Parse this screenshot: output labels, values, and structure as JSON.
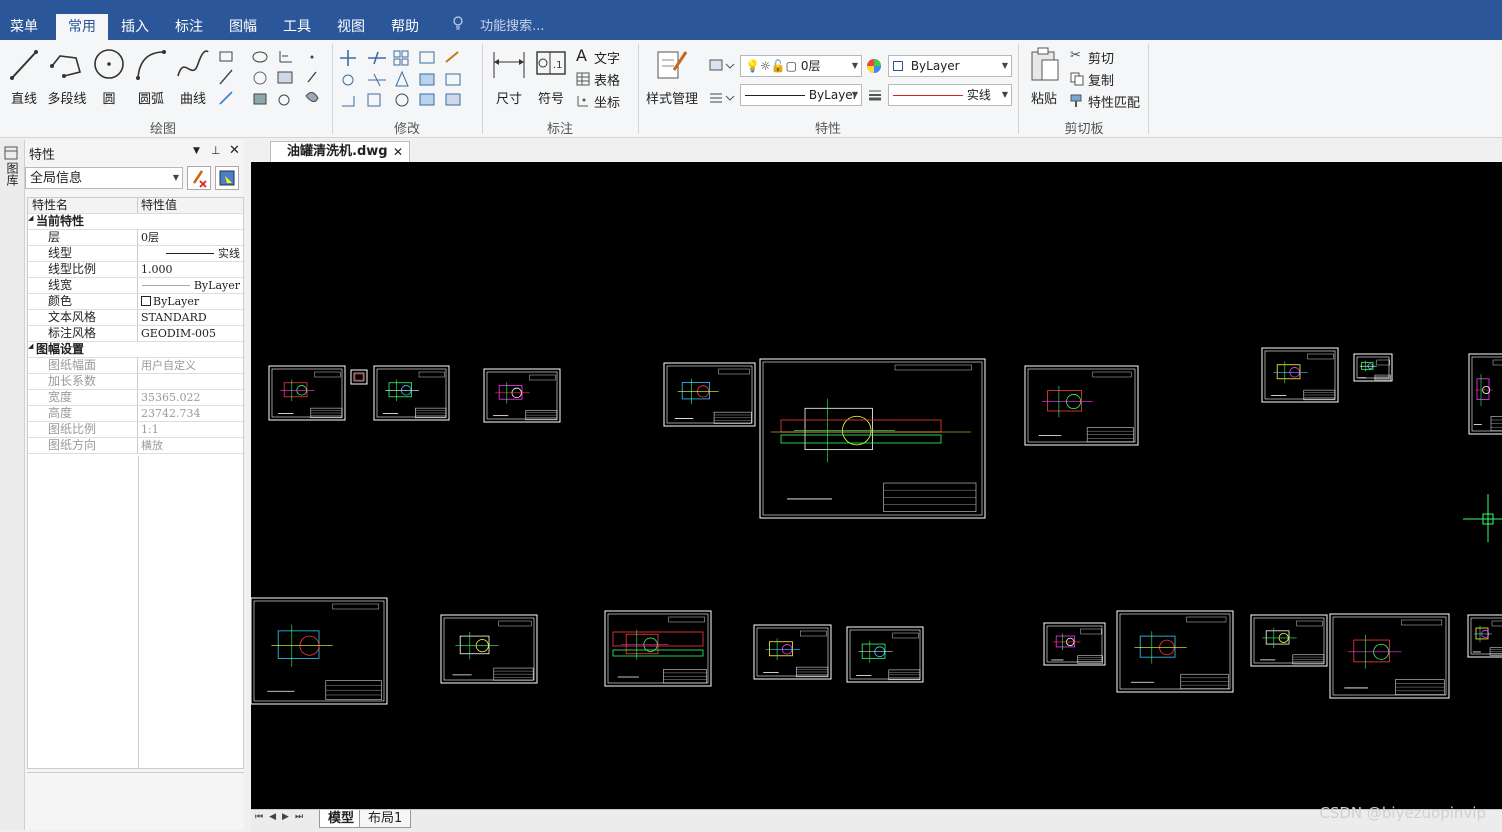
{
  "menu_tabs": [
    {
      "label": "菜单"
    },
    {
      "label": "常用",
      "active": true
    },
    {
      "label": "插入"
    },
    {
      "label": "标注"
    },
    {
      "label": "图幅"
    },
    {
      "label": "工具"
    },
    {
      "label": "视图"
    },
    {
      "label": "帮助"
    }
  ],
  "search_placeholder": "功能搜索...",
  "ribbon": {
    "draw": {
      "line": "直线",
      "polyline": "多段线",
      "circle": "圆",
      "arc": "圆弧",
      "curve": "曲线",
      "group_label": "绘图"
    },
    "modify": {
      "group_label": "修改"
    },
    "annotate": {
      "dimension": "尺寸",
      "symbol": "符号",
      "text": "文字",
      "table": "表格",
      "coordinate": "坐标",
      "group_label": "标注"
    },
    "properties": {
      "style_manager": "样式管理",
      "layer_value": "0层",
      "color_value": "ByLayer",
      "linetype_value": "ByLayer",
      "lineweight_value": "实线",
      "group_label": "特性"
    },
    "clipboard": {
      "paste": "粘贴",
      "cut": "剪切",
      "copy": "复制",
      "match": "特性匹配",
      "group_label": "剪切板"
    }
  },
  "sidebar": {
    "strip_label": "图库"
  },
  "properties_panel": {
    "title": "特性",
    "scope_value": "全局信息",
    "header_name": "特性名",
    "header_value": "特性值",
    "rows": [
      {
        "name": "当前特性",
        "value": "",
        "type": "section"
      },
      {
        "name": "层",
        "value": "0层"
      },
      {
        "name": "线型",
        "value": "实线"
      },
      {
        "name": "线型比例",
        "value": "1.000"
      },
      {
        "name": "线宽",
        "value": "ByLayer"
      },
      {
        "name": "颜色",
        "value": "ByLayer"
      },
      {
        "name": "文本风格",
        "value": "STANDARD"
      },
      {
        "name": "标注风格",
        "value": "GEODIM-005"
      },
      {
        "name": "图幅设置",
        "value": "",
        "type": "section"
      },
      {
        "name": "图纸幅面",
        "value": "用户自定义",
        "type": "muted"
      },
      {
        "name": "加长系数",
        "value": "",
        "type": "muted"
      },
      {
        "name": "宽度",
        "value": "35365.022",
        "type": "muted"
      },
      {
        "name": "高度",
        "value": "23742.734",
        "type": "muted"
      },
      {
        "name": "图纸比例",
        "value": "1:1",
        "type": "muted"
      },
      {
        "name": "图纸方向",
        "value": "横放",
        "type": "muted"
      }
    ]
  },
  "document_tab": {
    "label": "油罐清洗机.dwg"
  },
  "layout_tabs": [
    {
      "label": "模型",
      "active": true
    },
    {
      "label": "布局1"
    }
  ],
  "watermark": "CSDN @biyezuopinvip"
}
